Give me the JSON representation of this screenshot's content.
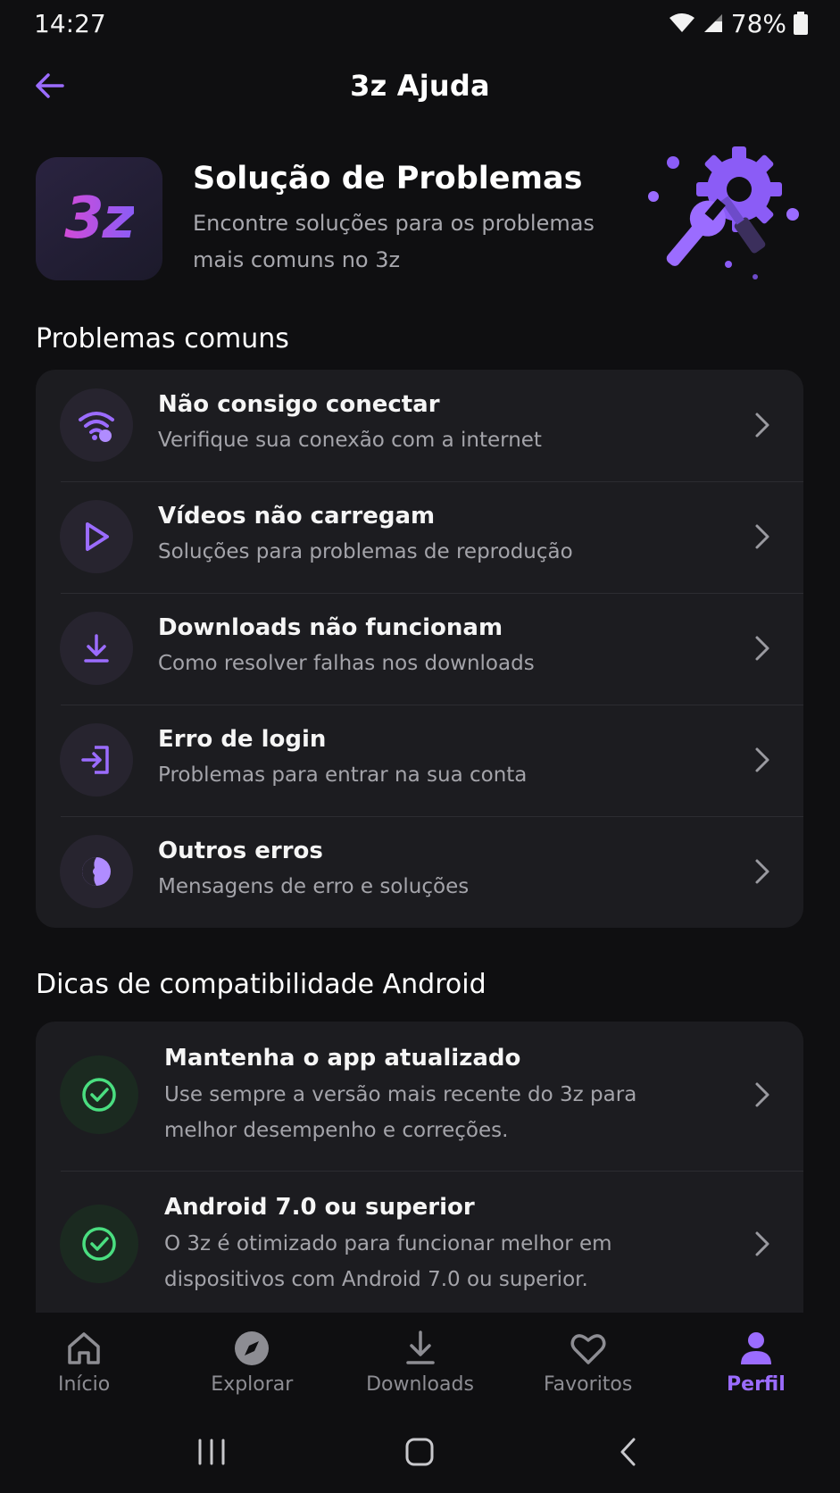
{
  "status_bar": {
    "time": "14:27",
    "battery": "78%"
  },
  "header": {
    "title": "3z Ajuda"
  },
  "hero": {
    "logo_text": "3z",
    "title": "Solução de Problemas",
    "subtitle": "Encontre soluções para os problemas mais comuns no 3z"
  },
  "common_problems": {
    "section_title": "Problemas comuns",
    "items": [
      {
        "icon": "wifi-error-icon",
        "title": "Não consigo conectar",
        "desc": "Verifique sua conexão com a internet"
      },
      {
        "icon": "play-icon",
        "title": "Vídeos não carregam",
        "desc": "Soluções para problemas de reprodução"
      },
      {
        "icon": "download-icon",
        "title": "Downloads não funcionam",
        "desc": "Como resolver falhas nos downloads"
      },
      {
        "icon": "login-icon",
        "title": "Erro de login",
        "desc": "Problemas para entrar na sua conta"
      },
      {
        "icon": "error-face-icon",
        "title": "Outros erros",
        "desc": "Mensagens de erro e soluções"
      }
    ]
  },
  "android_tips": {
    "section_title": "Dicas de compatibilidade Android",
    "items": [
      {
        "icon": "check-circle-icon",
        "title": "Mantenha o app atualizado",
        "desc": "Use sempre a versão mais recente do 3z para melhor desempenho e correções."
      },
      {
        "icon": "check-circle-icon",
        "title": "Android 7.0 ou superior",
        "desc": "O 3z é otimizado para funcionar melhor em dispositivos com Android 7.0 ou superior."
      }
    ]
  },
  "bottom_nav": {
    "items": [
      {
        "icon": "home-icon",
        "label": "Início"
      },
      {
        "icon": "compass-icon",
        "label": "Explorar"
      },
      {
        "icon": "download-icon",
        "label": "Downloads"
      },
      {
        "icon": "heart-icon",
        "label": "Favoritos"
      },
      {
        "icon": "person-icon",
        "label": "Perfil"
      }
    ],
    "active": "Perfil"
  },
  "colors": {
    "accent": "#9b6cff",
    "success": "#4ade80",
    "background": "#0f0f11",
    "card": "#1c1c20"
  }
}
